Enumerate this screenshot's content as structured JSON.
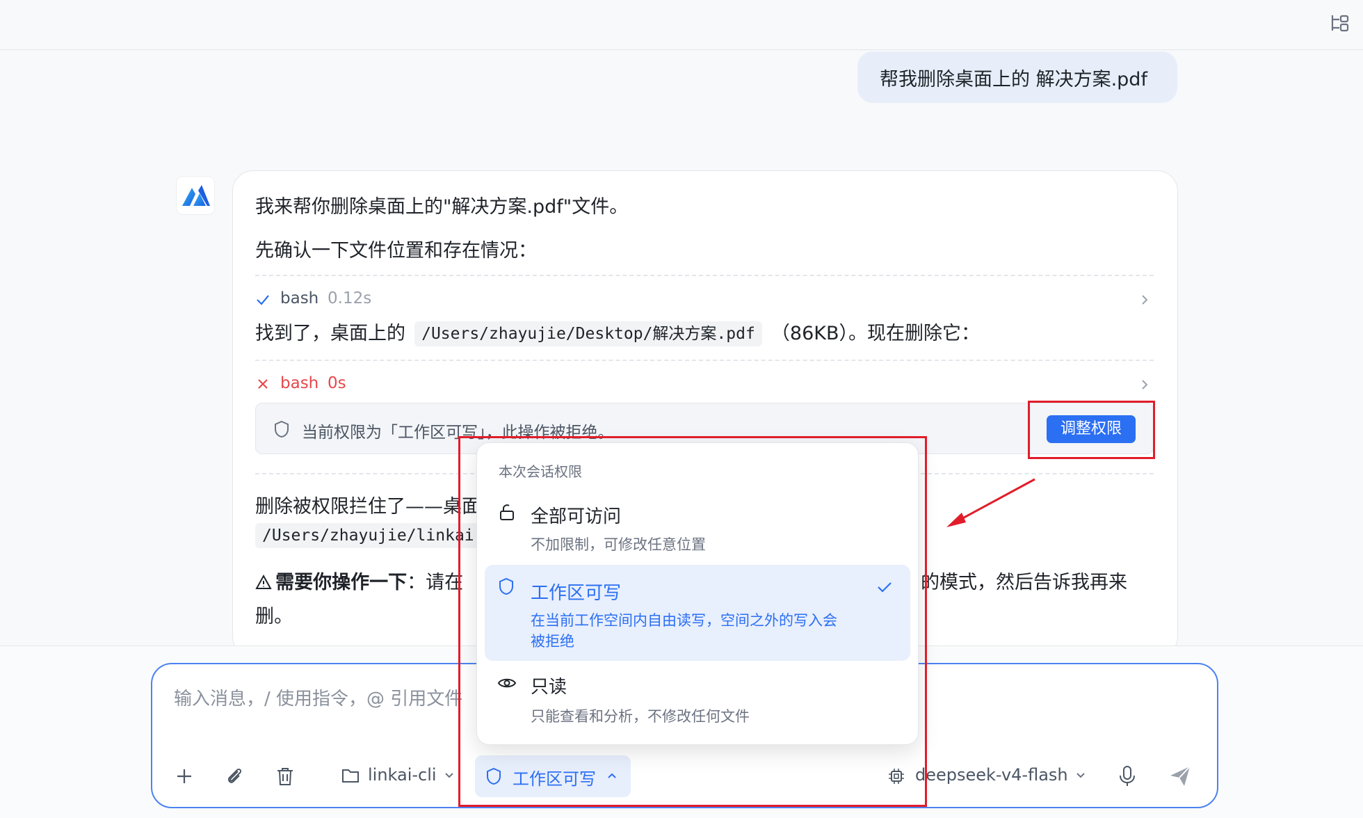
{
  "user_message": "帮我删除桌面上的 解决方案.pdf",
  "assistant": {
    "intro": "我来帮你删除桌面上的\"解决方案.pdf\"文件。",
    "confirm": "先确认一下文件位置和存在情况：",
    "tool1": {
      "name": "bash",
      "duration": "0.12s"
    },
    "found_prefix": "找到了，桌面上的",
    "found_path": "/Users/zhayujie/Desktop/解决方案.pdf",
    "found_suffix": "（86KB）。现在删除它：",
    "tool2": {
      "name": "bash",
      "duration": "0s"
    },
    "denied_text": "当前权限为「工作区可写」，此操作被拒绝。",
    "adjust_button": "调整权限",
    "blocked_text": "删除被权限拦住了——桌面",
    "blocked_path": "/Users/zhayujie/linkai",
    "action_bold": "需要你操作一下",
    "action_colon": "：请在",
    "action_right": "的模式，然后告诉我再来",
    "action_line2": "删。"
  },
  "composer": {
    "placeholder": "输入消息，/ 使用指令，@ 引用文件",
    "workspace": "linkai-cli",
    "permission": "工作区可写",
    "model": "deepseek-v4-flash"
  },
  "permission_menu": {
    "header": "本次会话权限",
    "options": [
      {
        "title": "全部可访问",
        "desc": "不加限制，可修改任意位置",
        "icon": "unlock-icon",
        "selected": false
      },
      {
        "title": "工作区可写",
        "desc1": "在当前工作空间内自由读写，空间之外的写入会",
        "desc2": "被拒绝",
        "icon": "shield-icon",
        "selected": true
      },
      {
        "title": "只读",
        "desc": "只能查看和分析，不修改任何文件",
        "icon": "eye-icon",
        "selected": false
      }
    ]
  },
  "colors": {
    "accent": "#2b6ff3",
    "error": "#e5484d",
    "annotation": "#e11d2a"
  }
}
